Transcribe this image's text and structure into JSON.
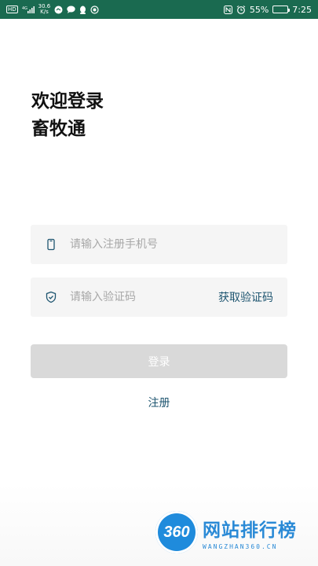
{
  "status_bar": {
    "hd_label": "HD",
    "signal_label": "4G",
    "speed_value": "30.6",
    "speed_unit": "K/s",
    "battery_percent": "55%",
    "battery_level": 0.55,
    "time": "7:25"
  },
  "title": {
    "line1": "欢迎登录",
    "line2": "畜牧通"
  },
  "phone_field": {
    "placeholder": "请输入注册手机号",
    "icon": "phone-icon"
  },
  "code_field": {
    "placeholder": "请输入验证码",
    "icon": "shield-check-icon",
    "get_code_label": "获取验证码"
  },
  "login_button": {
    "label": "登录"
  },
  "register_link": {
    "label": "注册"
  },
  "watermark": {
    "logo_text": "360",
    "main_text": "网站排行榜",
    "sub_text": "WANGZHAN360.CN"
  },
  "colors": {
    "status_bar_bg": "#1a6a50",
    "accent_link": "#1e5570",
    "button_disabled_bg": "#d9d9d9",
    "field_bg": "#f5f5f5"
  }
}
